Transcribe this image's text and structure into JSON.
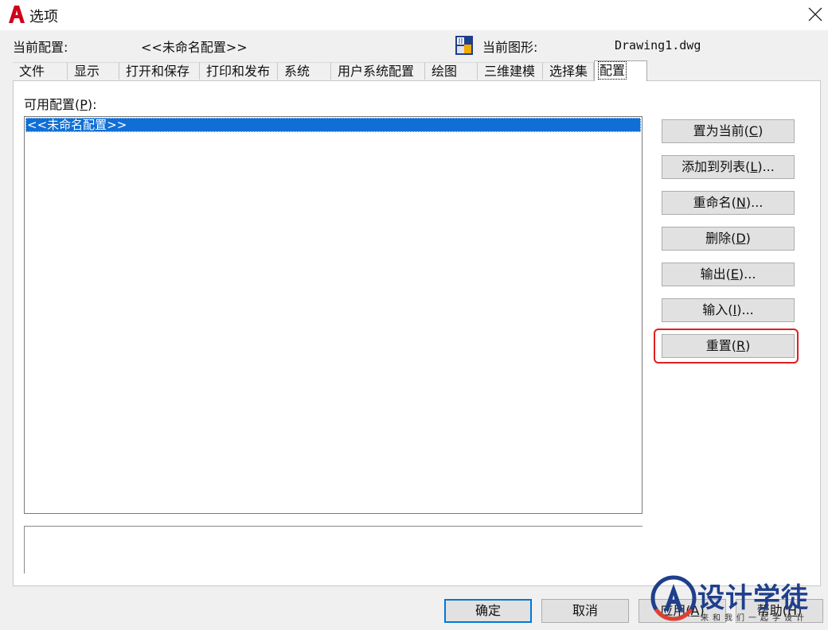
{
  "window": {
    "title": "选项"
  },
  "header": {
    "profile_label": "当前配置:",
    "profile_value": "<<未命名配置>>",
    "drawing_label": "当前图形:",
    "drawing_value": "Drawing1.dwg"
  },
  "tabs": [
    {
      "label": "文件"
    },
    {
      "label": "显示"
    },
    {
      "label": "打开和保存"
    },
    {
      "label": "打印和发布"
    },
    {
      "label": "系统"
    },
    {
      "label": "用户系统配置"
    },
    {
      "label": "绘图"
    },
    {
      "label": "三维建模"
    },
    {
      "label": "选择集"
    },
    {
      "label": "配置",
      "active": true
    }
  ],
  "profiles": {
    "label_prefix": "可用配置(",
    "label_key": "P",
    "label_suffix": "):",
    "items": [
      "<<未命名配置>>"
    ]
  },
  "side_buttons": [
    {
      "pre": "置为当前(",
      "key": "C",
      "post": ")"
    },
    {
      "pre": "添加到列表(",
      "key": "L",
      "post": ")..."
    },
    {
      "pre": "重命名(",
      "key": "N",
      "post": ")..."
    },
    {
      "pre": "删除(",
      "key": "D",
      "post": ")"
    },
    {
      "pre": "输出(",
      "key": "E",
      "post": ")..."
    },
    {
      "pre": "输入(",
      "key": "I",
      "post": ")..."
    },
    {
      "pre": "重置(",
      "key": "R",
      "post": ")"
    }
  ],
  "bottom_buttons": {
    "ok": "确定",
    "cancel": "取消",
    "apply_pre": "应用(",
    "apply_key": "A",
    "apply_post": ")",
    "help_pre": "帮助(",
    "help_key": "H",
    "help_post": ")"
  },
  "watermark": {
    "text": "设计学徒",
    "sub": "来和我们一起学设计"
  },
  "colors": {
    "selection": "#0f6fd6",
    "highlight": "#e0201e",
    "logo": "#d0021b"
  }
}
